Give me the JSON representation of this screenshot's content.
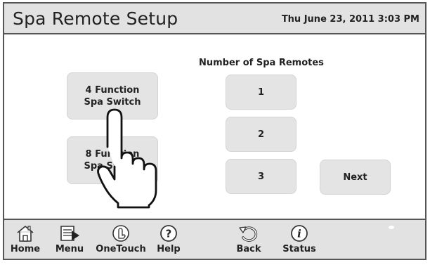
{
  "header": {
    "title": "Spa Remote Setup",
    "datetime": "Thu June 23, 2011  3:03 PM"
  },
  "left_buttons": [
    {
      "line1": "4 Function",
      "line2": "Spa  Switch"
    },
    {
      "line1": "8 Function",
      "line2": "Spa Switch"
    }
  ],
  "remotes": {
    "label": "Number of Spa Remotes",
    "options": [
      "1",
      "2",
      "3"
    ]
  },
  "next_label": "Next",
  "toolbar": {
    "items": [
      {
        "label": "Home",
        "icon": "home-icon"
      },
      {
        "label": "Menu",
        "icon": "menu-icon"
      },
      {
        "label": "OneTouch",
        "icon": "onetouch-icon"
      },
      {
        "label": "Help",
        "icon": "help-icon"
      },
      {
        "label": "Back",
        "icon": "back-icon"
      },
      {
        "label": "Status",
        "icon": "status-icon"
      }
    ]
  },
  "colors": {
    "header_bg": "#e2e2e2",
    "button_bg": "#e4e4e4",
    "border": "#555555"
  }
}
